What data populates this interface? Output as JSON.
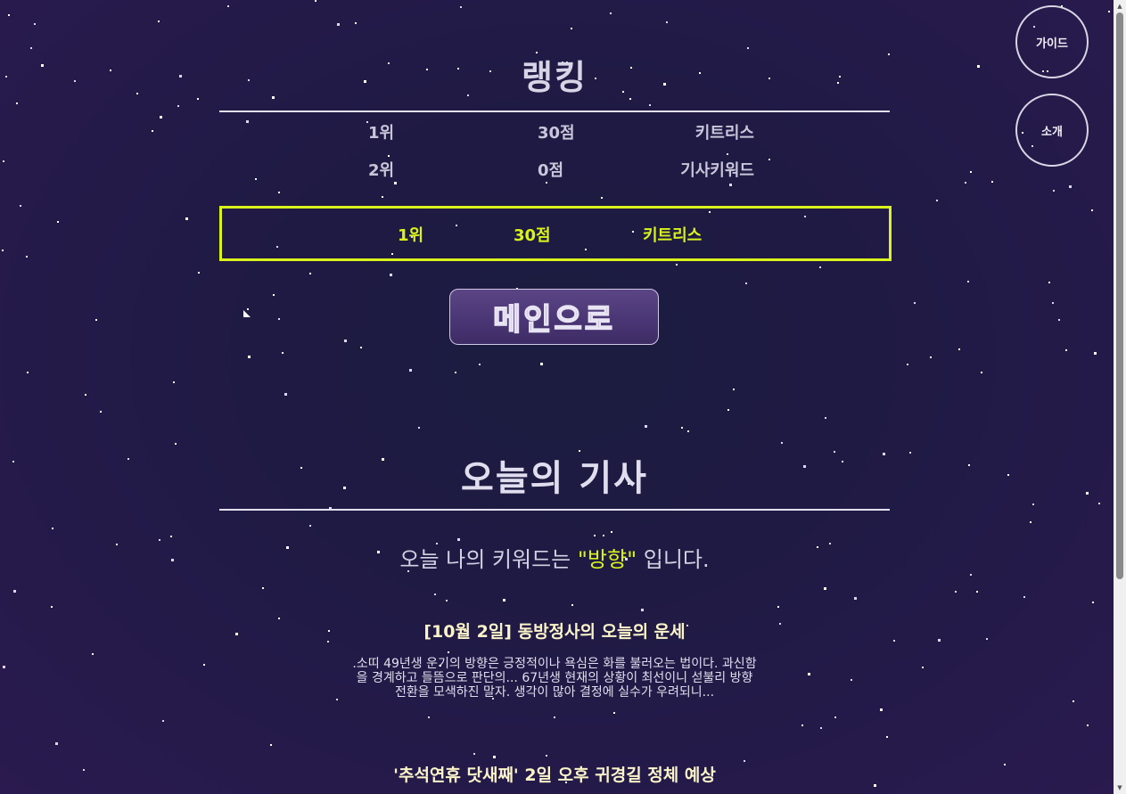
{
  "nav": {
    "guide_label": "가이드",
    "about_label": "소개"
  },
  "ranking": {
    "title": "랭킹",
    "rows": [
      {
        "rank": "1위",
        "score": "30점",
        "name": "키트리스"
      },
      {
        "rank": "2위",
        "score": "0점",
        "name": "기사키워드"
      }
    ],
    "my_rank": {
      "rank": "1위",
      "score": "30점",
      "name": "키트리스"
    },
    "my_rank_color": "#d9f31b"
  },
  "main_button_label": "메인으로",
  "news": {
    "title": "오늘의 기사",
    "keyword_prefix": "오늘 나의 키워드는 ",
    "keyword": "\"방향\"",
    "keyword_suffix": " 입니다.",
    "articles": [
      {
        "headline": "[10월 2일] 동방정사의 오늘의 운세",
        "body": ".소띠 49년생 운기의 방향은 긍정적이나 욕심은 화를 불러오는 법이다. 과신함을 경계하고 들뜸으로 판단의... 67년생 현재의 상황이 최선이니 섣불리 방향 전환을 모색하진 말자. 생각이 많아 결정에 실수가 우려되니..."
      },
      {
        "headline": "'추석연휴 닷새째' 2일 오후 귀경길 정체 예상",
        "body": ""
      }
    ]
  },
  "colors": {
    "background": "#1f1a44",
    "accent": "#d9f31b",
    "headline": "#fbf4c8"
  }
}
